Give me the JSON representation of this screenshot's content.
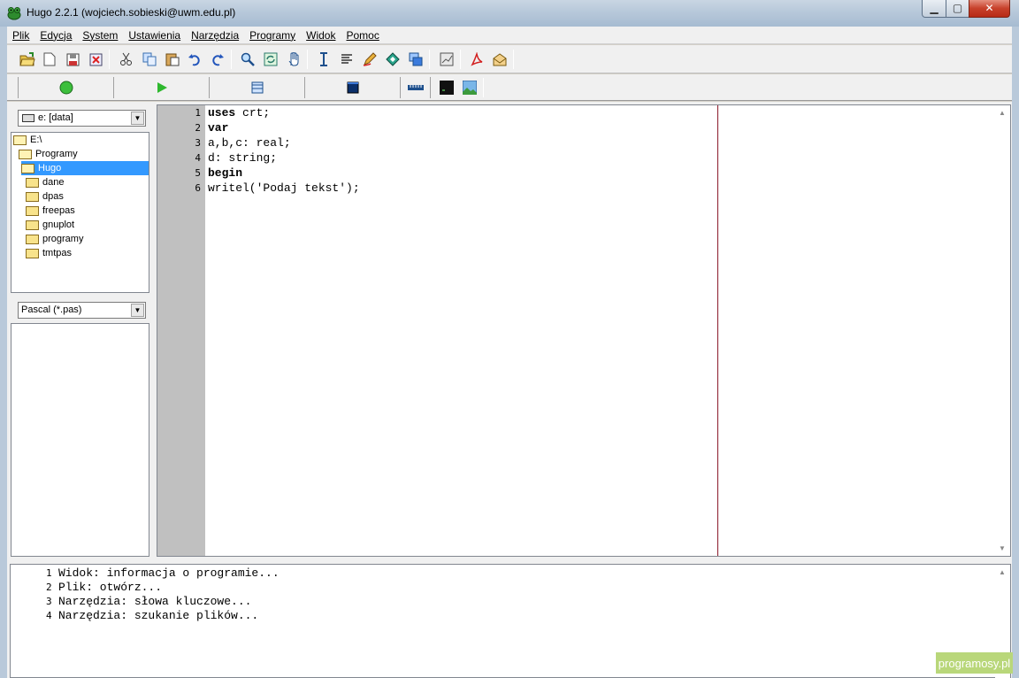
{
  "window": {
    "title": "Hugo 2.2.1 (wojciech.sobieski@uwm.edu.pl)",
    "icon": "frog-icon"
  },
  "menu": [
    "Plik",
    "Edycja",
    "System",
    "Ustawienia",
    "Narzędzia",
    "Programy",
    "Widok",
    "Pomoc"
  ],
  "toolbar1": [
    "open-folder-icon",
    "new-file-icon",
    "save-icon",
    "close-file-icon",
    "cut-icon",
    "copy-icon",
    "paste-icon",
    "undo-icon",
    "redo-icon",
    "find-icon",
    "replace-icon",
    "hand-icon",
    "text-cursor-icon",
    "list-icon",
    "pen-icon",
    "diamond-icon",
    "windows-icon",
    "chart-icon",
    "pdf-icon",
    "mail-icon"
  ],
  "toolbar2": [
    "compile-circle-icon",
    "run-play-icon",
    "window-icon",
    "blue-square-icon",
    "ruler-icon",
    "terminal-icon",
    "image-icon"
  ],
  "sidebar": {
    "drive": "e: [data]",
    "tree": [
      {
        "label": "E:\\",
        "level": 0,
        "open": true
      },
      {
        "label": "Programy",
        "level": 1,
        "open": true
      },
      {
        "label": "Hugo",
        "level": 2,
        "open": true,
        "selected": true
      },
      {
        "label": "dane",
        "level": 3
      },
      {
        "label": "dpas",
        "level": 3
      },
      {
        "label": "freepas",
        "level": 3
      },
      {
        "label": "gnuplot",
        "level": 3
      },
      {
        "label": "programy",
        "level": 3
      },
      {
        "label": "tmtpas",
        "level": 3
      }
    ],
    "filter": "Pascal (*.pas)"
  },
  "editor": {
    "lines": [
      "uses crt;",
      "var",
      "a,b,c: real;",
      "d: string;",
      "begin",
      "writel('Podaj tekst');"
    ],
    "bold_keywords": [
      "uses",
      "var",
      "begin"
    ]
  },
  "output": {
    "lines": [
      "Widok: informacja o programie...",
      "Plik: otwórz...",
      "Narzędzia: słowa kluczowe...",
      "Narzędzia: szukanie plików..."
    ]
  },
  "watermark": "programosy.pl"
}
